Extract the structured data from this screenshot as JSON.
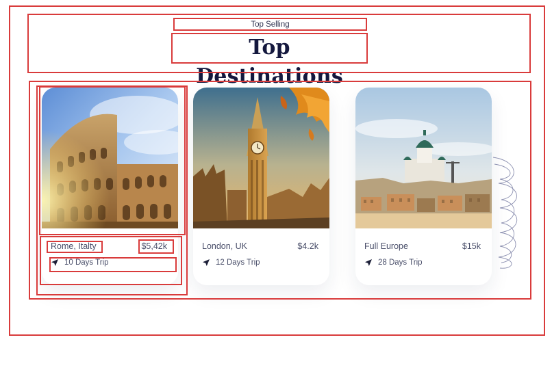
{
  "header": {
    "subtitle": "Top Selling",
    "title": "Top Destinations"
  },
  "destinations": [
    {
      "place": "Rome, Italty",
      "price": "$5,42k",
      "trip": "10 Days Trip",
      "icon": "navigation-arrow-icon"
    },
    {
      "place": "London, UK",
      "price": "$4.2k",
      "trip": "12 Days Trip",
      "icon": "navigation-arrow-icon"
    },
    {
      "place": "Full Europe",
      "price": "$15k",
      "trip": "28 Days Trip",
      "icon": "navigation-arrow-icon"
    }
  ],
  "colors": {
    "title": "#14183e",
    "text": "#4a4f6a",
    "wireframe": "#d93b3b"
  }
}
